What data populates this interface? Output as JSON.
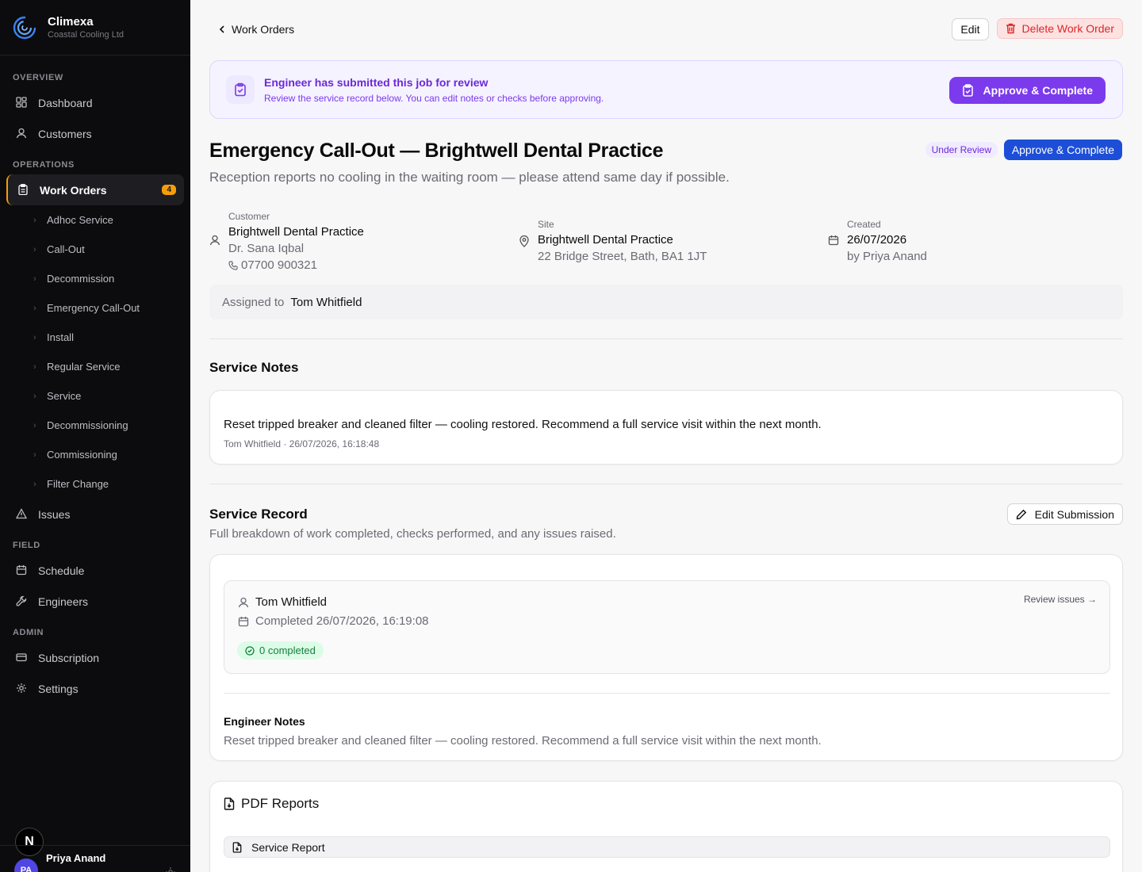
{
  "brand": {
    "name": "Climexa",
    "sub": "Coastal Cooling Ltd"
  },
  "nav": {
    "overview_label": "OVERVIEW",
    "dashboard": "Dashboard",
    "customers": "Customers",
    "operations_label": "OPERATIONS",
    "work_orders": "Work Orders",
    "work_orders_count": "4",
    "sub_items": [
      "Adhoc Service",
      "Call-Out",
      "Decommission",
      "Emergency Call-Out",
      "Install",
      "Regular Service",
      "Service",
      "Decommissioning",
      "Commissioning",
      "Filter Change"
    ],
    "issues": "Issues",
    "field_label": "FIELD",
    "schedule": "Schedule",
    "engineers": "Engineers",
    "admin_label": "ADMIN",
    "subscription": "Subscription",
    "settings": "Settings"
  },
  "user": {
    "initials": "PA",
    "name": "Priya Anand"
  },
  "next_badge": "N",
  "header": {
    "back_label": "Work Orders",
    "edit_label": "Edit",
    "delete_label": "Delete Work Order"
  },
  "banner": {
    "title": "Engineer has submitted this job for review",
    "subtitle": "Review the service record below. You can edit notes or checks before approving.",
    "action": "Approve & Complete"
  },
  "job": {
    "title": "Emergency Call-Out — Brightwell Dental Practice",
    "description": "Reception reports no cooling in the waiting room — please attend same day if possible.",
    "status": "Under Review",
    "action": "Approve & Complete"
  },
  "customer": {
    "label": "Customer",
    "name": "Brightwell Dental Practice",
    "contact": "Dr. Sana Iqbal",
    "phone": "07700 900321"
  },
  "site": {
    "label": "Site",
    "name": "Brightwell Dental Practice",
    "address": "22 Bridge Street, Bath, BA1 1JT"
  },
  "created": {
    "label": "Created",
    "date": "26/07/2026",
    "by": "by Priya Anand"
  },
  "assigned": {
    "label": "Assigned to",
    "name": "Tom Whitfield"
  },
  "service_notes": {
    "title": "Service Notes",
    "text": "Reset tripped breaker and cleaned filter — cooling restored. Recommend a full service visit within the next month.",
    "meta": "Tom Whitfield · 26/07/2026, 16:18:48"
  },
  "service_record": {
    "title": "Service Record",
    "subtitle": "Full breakdown of work completed, checks performed, and any issues raised.",
    "edit_label": "Edit Submission",
    "engineer": "Tom Whitfield",
    "completed": "Completed 26/07/2026, 16:19:08",
    "review_link": "Review issues →",
    "completed_count": "0 completed",
    "notes_title": "Engineer Notes",
    "notes_text": "Reset tripped breaker and cleaned filter — cooling restored. Recommend a full service visit within the next month."
  },
  "pdf": {
    "title": "PDF Reports",
    "item": "Service Report"
  },
  "colors": {
    "accent_purple": "#7c3aed",
    "accent_blue": "#1d4ed8",
    "sidebar_bg": "#0c0c0e",
    "active_badge": "#f59e0b",
    "danger": "#dc2626"
  }
}
